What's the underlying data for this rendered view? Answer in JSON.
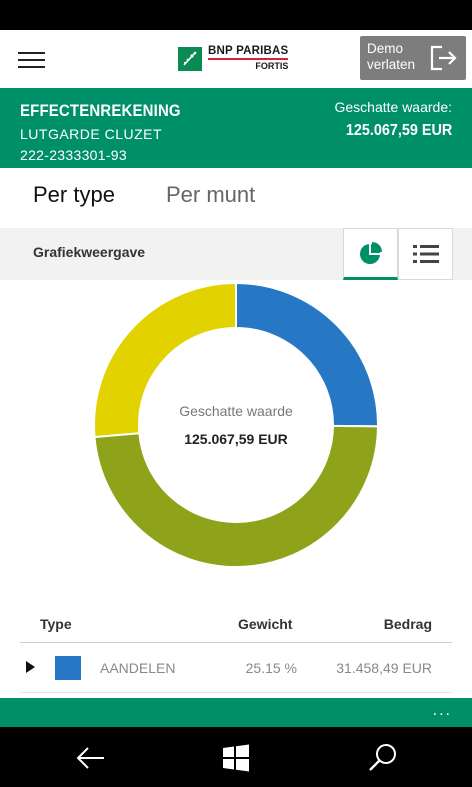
{
  "app": {
    "brand_line1": "BNP PARIBAS",
    "brand_line2": "FORTIS",
    "demo_button": {
      "line1": "Demo",
      "line2": "verlaten"
    }
  },
  "account": {
    "title": "EFFECTENREKENING",
    "holder": "LUTGARDE CLUZET",
    "number": "222-2333301-93",
    "estimated_label": "Geschatte waarde:",
    "estimated_value": "125.067,59  EUR"
  },
  "tabs": [
    {
      "label": "Per type",
      "active": true
    },
    {
      "label": "Per munt",
      "active": false
    }
  ],
  "view": {
    "label": "Grafiekweergave",
    "selected": "pie-icon"
  },
  "chart_center": {
    "label": "Geschatte waarde",
    "value": "125.067,59 EUR"
  },
  "chart_data": {
    "type": "pie",
    "segments": [
      {
        "value": 25.15,
        "color": "#2677c4"
      },
      {
        "value": 48.5,
        "color": "#8fa31a"
      },
      {
        "value": 26.35,
        "color": "#e2d300"
      }
    ]
  },
  "table": {
    "headers": {
      "type": "Type",
      "weight": "Gewicht",
      "amount": "Bedrag"
    },
    "rows": [
      {
        "type": "AANDELEN",
        "weight": "25.15 %",
        "amount": "31.458,49 EUR",
        "color": "#2677c4"
      }
    ]
  },
  "bottom": {
    "more": "..."
  },
  "colors": {
    "brand": "#009067",
    "accent_red": "#d4213d"
  },
  "icons": {
    "back": "back-arrow-icon",
    "home": "windows-icon",
    "search": "search-icon"
  }
}
